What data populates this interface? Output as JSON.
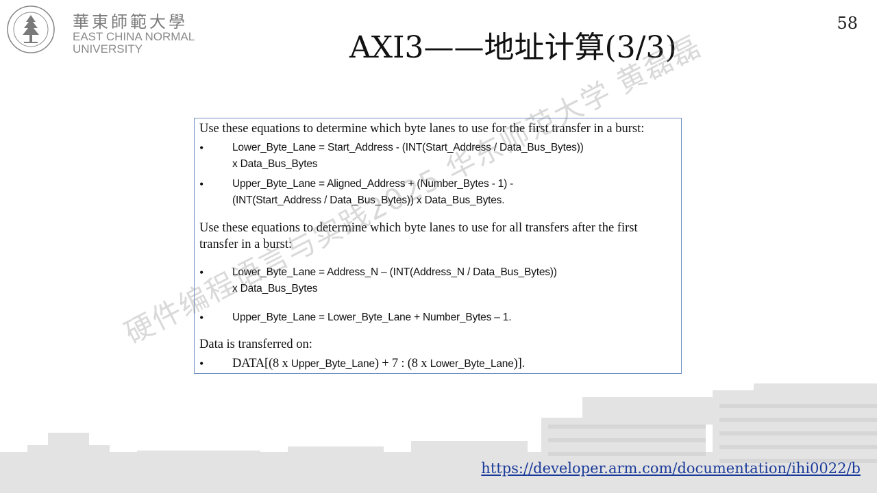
{
  "logo": {
    "cn_name": "華東師範大學",
    "en_line1": "EAST CHINA NORMAL",
    "en_line2": "UNIVERSITY",
    "emblem_icon": "pine-tree-seal-icon"
  },
  "page_number": "58",
  "title": "AXI3——地址计算(3/3)",
  "content": {
    "para1": "Use these equations to determine which byte lanes to use for the first transfer in a burst:",
    "first_bullets": [
      {
        "line1": "Lower_Byte_Lane = Start_Address - (INT(Start_Address / Data_Bus_Bytes))",
        "line2": "x Data_Bus_Bytes"
      },
      {
        "line1": "Upper_Byte_Lane = Aligned_Address + (Number_Bytes - 1) -",
        "line2": "(INT(Start_Address / Data_Bus_Bytes)) x Data_Bus_Bytes."
      }
    ],
    "para2_line1": "Use these equations to determine which byte lanes to use for all transfers after the first",
    "para2_line2": "transfer in a burst:",
    "later_bullets": [
      {
        "line1": "Lower_Byte_Lane = Address_N – (INT(Address_N / Data_Bus_Bytes))",
        "line2": "x Data_Bus_Bytes"
      },
      {
        "line1": "Upper_Byte_Lane = Lower_Byte_Lane + Number_Bytes – 1."
      }
    ],
    "para3": "Data is transferred on:",
    "data_bullet": {
      "prefix": "DATA[(8 x ",
      "term1": "Upper_Byte_Lane",
      "middle": ") + 7 : (8 x ",
      "term2": "Lower_Byte_Lane",
      "suffix": ")]."
    },
    "bullet_symbol": "•"
  },
  "watermark": "硬件编程语言与实践2025 华东师范大学 黄磊磊",
  "source_link": "https://developer.arm.com/documentation/ihi0022/b",
  "colors": {
    "box_border": "#6d8fc4",
    "link": "#1a3a9a",
    "logo_gray": "#7a7a7a"
  }
}
